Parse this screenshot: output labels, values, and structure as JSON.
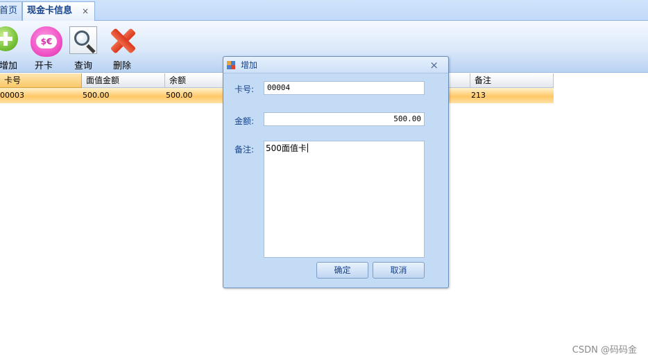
{
  "tabs": [
    {
      "label": "首页"
    },
    {
      "label": "现金卡信息",
      "close": "×"
    }
  ],
  "toolbar": {
    "buttons": [
      {
        "label": "增加",
        "icon": "plus-circle-icon"
      },
      {
        "label": "开卡",
        "icon": "money-pig-icon"
      },
      {
        "label": "查询",
        "icon": "magnifier-icon"
      },
      {
        "label": "删除",
        "icon": "red-x-icon"
      }
    ]
  },
  "grid": {
    "columns": [
      "卡号",
      "面值金额",
      "余额",
      "备注"
    ],
    "rows": [
      {
        "card_no": "00003",
        "face_value": "500.00",
        "balance": "500.00",
        "remark": "213"
      }
    ]
  },
  "dialog": {
    "title": "增加",
    "close": "×",
    "card_no_label": "卡号:",
    "card_no_value": "00004",
    "amount_label": "金额:",
    "amount_value": "500.00",
    "remark_label": "备注:",
    "remark_value": "500面值卡",
    "ok_label": "确定",
    "cancel_label": "取消"
  },
  "watermark": "CSDN @码码金",
  "colors": {
    "selected_row": "#ffc868",
    "toolbar_bg": "#dce9fa",
    "dialog_bg": "#c4dbf6",
    "title_text": "#15428b"
  }
}
